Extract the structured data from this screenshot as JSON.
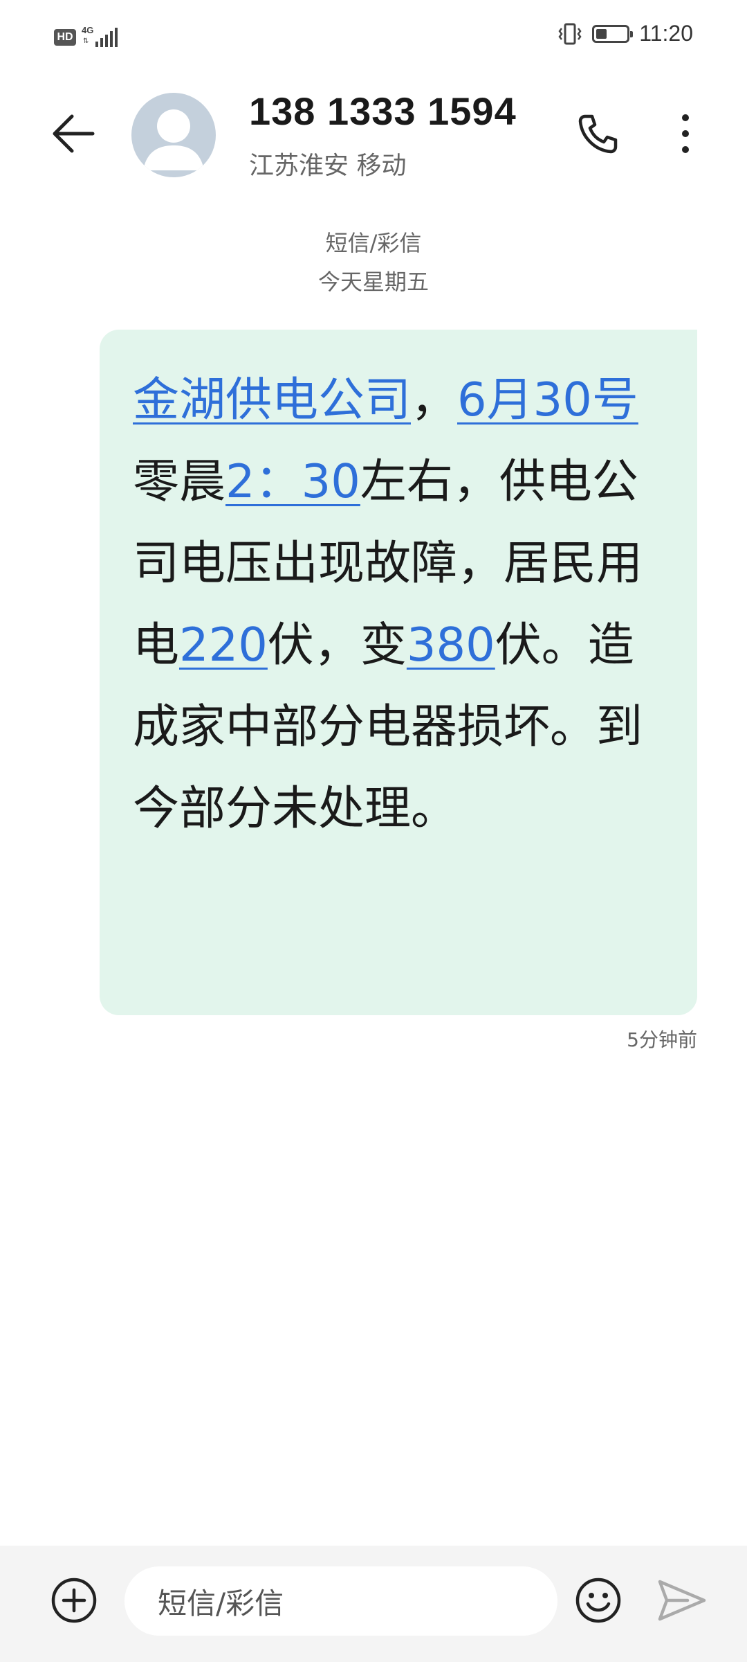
{
  "status_bar": {
    "hd": "HD",
    "network": "4G",
    "time": "11:20",
    "battery_level": 0.35
  },
  "header": {
    "contact_number": "138 1333 1594",
    "contact_location": "江苏淮安 移动"
  },
  "meta": {
    "channel": "短信/彩信",
    "day": "今天星期五"
  },
  "message": {
    "segments": [
      {
        "text": "金湖供电公司",
        "link": true
      },
      {
        "text": "，",
        "link": false
      },
      {
        "text": "6月30号",
        "link": true
      },
      {
        "text": "零晨",
        "link": false
      },
      {
        "text": "2：30",
        "link": true
      },
      {
        "text": "左右，供电公司电压出现故障，居民用电",
        "link": false
      },
      {
        "text": "220",
        "link": true
      },
      {
        "text": "伏，变",
        "link": false
      },
      {
        "text": "380",
        "link": true
      },
      {
        "text": "伏。造成家中部分电器损坏。到今部分未处理。",
        "link": false
      }
    ],
    "time": "5分钟前"
  },
  "input": {
    "placeholder": "短信/彩信"
  },
  "colors": {
    "bubble": "#e2f5ec",
    "link": "#2e6fd9",
    "input_bar": "#f4f4f4"
  },
  "icons": [
    "back-arrow-icon",
    "phone-icon",
    "more-vert-icon",
    "add-icon",
    "emoji-icon",
    "send-icon"
  ]
}
